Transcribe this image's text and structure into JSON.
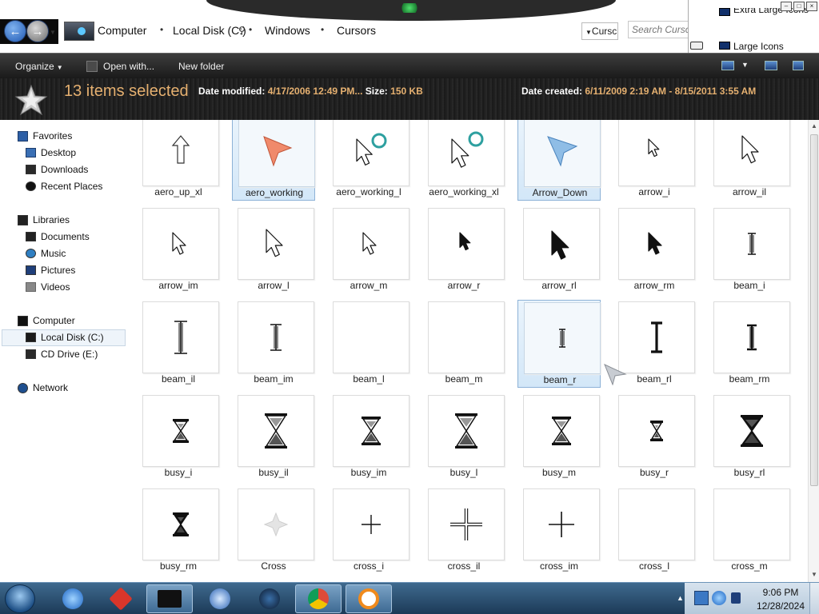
{
  "address": {
    "crumbs": [
      "Computer",
      "Local Disk (C:)",
      "Windows",
      "Cursors"
    ],
    "dropdown_text": "Cursc",
    "search_placeholder": "Search Cursors"
  },
  "view_menu": {
    "items": [
      "Extra Large Icons",
      "Large Icons"
    ]
  },
  "toolbar": {
    "organize": "Organize",
    "open_with": "Open with...",
    "new_folder": "New folder"
  },
  "details": {
    "selection": "13 items selected",
    "date_modified_label": "Date modified:",
    "date_modified_value": "4/17/2006 12:49 PM...",
    "size_label": "Size:",
    "size_value": "150 KB",
    "date_created_label": "Date created:",
    "date_created_value": "6/11/2009 2:19 AM - 8/15/2011 3:55 AM"
  },
  "nav": {
    "favorites": "Favorites",
    "desktop": "Desktop",
    "downloads": "Downloads",
    "recent_places": "Recent Places",
    "libraries": "Libraries",
    "documents": "Documents",
    "music": "Music",
    "pictures": "Pictures",
    "videos": "Videos",
    "computer": "Computer",
    "local_disk": "Local Disk (C:)",
    "cd_drive": "CD Drive (E:)",
    "network": "Network"
  },
  "files": [
    {
      "name": "aero_up_xl",
      "icon": "up-arrow-outline",
      "selected": false
    },
    {
      "name": "aero_working",
      "icon": "aero-pointer-orange",
      "selected": true
    },
    {
      "name": "aero_working_l",
      "icon": "pointer-busy-ring",
      "selected": false
    },
    {
      "name": "aero_working_xl",
      "icon": "pointer-busy-ring-large",
      "selected": false
    },
    {
      "name": "Arrow_Down",
      "icon": "aero-pointer-blue",
      "selected": true
    },
    {
      "name": "arrow_i",
      "icon": "arrow-outline-small",
      "selected": false
    },
    {
      "name": "arrow_il",
      "icon": "arrow-outline-large",
      "selected": false
    },
    {
      "name": "arrow_im",
      "icon": "arrow-outline-medium",
      "selected": false
    },
    {
      "name": "arrow_l",
      "icon": "arrow-outline-large",
      "selected": false
    },
    {
      "name": "arrow_m",
      "icon": "arrow-outline-medium",
      "selected": false
    },
    {
      "name": "arrow_r",
      "icon": "arrow-black-small",
      "selected": false
    },
    {
      "name": "arrow_rl",
      "icon": "arrow-black-large",
      "selected": false
    },
    {
      "name": "arrow_rm",
      "icon": "arrow-black-medium",
      "selected": false
    },
    {
      "name": "beam_i",
      "icon": "ibeam-outline-small",
      "selected": false
    },
    {
      "name": "beam_il",
      "icon": "ibeam-outline-large",
      "selected": false
    },
    {
      "name": "beam_im",
      "icon": "ibeam-outline-medium",
      "selected": false
    },
    {
      "name": "beam_l",
      "icon": "blank",
      "selected": false
    },
    {
      "name": "beam_m",
      "icon": "blank",
      "selected": false
    },
    {
      "name": "beam_r",
      "icon": "ibeam-thin",
      "selected": true
    },
    {
      "name": "beam_rl",
      "icon": "ibeam-black-large",
      "selected": false
    },
    {
      "name": "beam_rm",
      "icon": "ibeam-black-medium",
      "selected": false
    },
    {
      "name": "busy_i",
      "icon": "hourglass-small",
      "selected": false
    },
    {
      "name": "busy_il",
      "icon": "hourglass-large",
      "selected": false
    },
    {
      "name": "busy_im",
      "icon": "hourglass-medium",
      "selected": false
    },
    {
      "name": "busy_l",
      "icon": "hourglass-large",
      "selected": false
    },
    {
      "name": "busy_m",
      "icon": "hourglass-medium",
      "selected": false
    },
    {
      "name": "busy_r",
      "icon": "hourglass-tiny",
      "selected": false
    },
    {
      "name": "busy_rl",
      "icon": "hourglass-black",
      "selected": false
    },
    {
      "name": "busy_rm",
      "icon": "hourglass-black-small",
      "selected": false
    },
    {
      "name": "Cross",
      "icon": "cross-faded",
      "selected": false
    },
    {
      "name": "cross_i",
      "icon": "cross-small",
      "selected": false
    },
    {
      "name": "cross_il",
      "icon": "cross-large",
      "selected": false
    },
    {
      "name": "cross_im",
      "icon": "cross-medium",
      "selected": false
    },
    {
      "name": "cross_l",
      "icon": "blank",
      "selected": false
    },
    {
      "name": "cross_m",
      "icon": "blank",
      "selected": false
    }
  ],
  "taskbar": {
    "time": "9:06 PM",
    "date": "12/28/2024",
    "apps": [
      "internet-explorer-icon",
      "red-box-icon",
      "monitor-icon",
      "media-player-icon",
      "dark-orb-icon",
      "chrome-icon",
      "search-magnifier-icon"
    ]
  },
  "colors": {
    "accent_orange": "#e5b070",
    "selection_blue": "#d3e7f8"
  }
}
